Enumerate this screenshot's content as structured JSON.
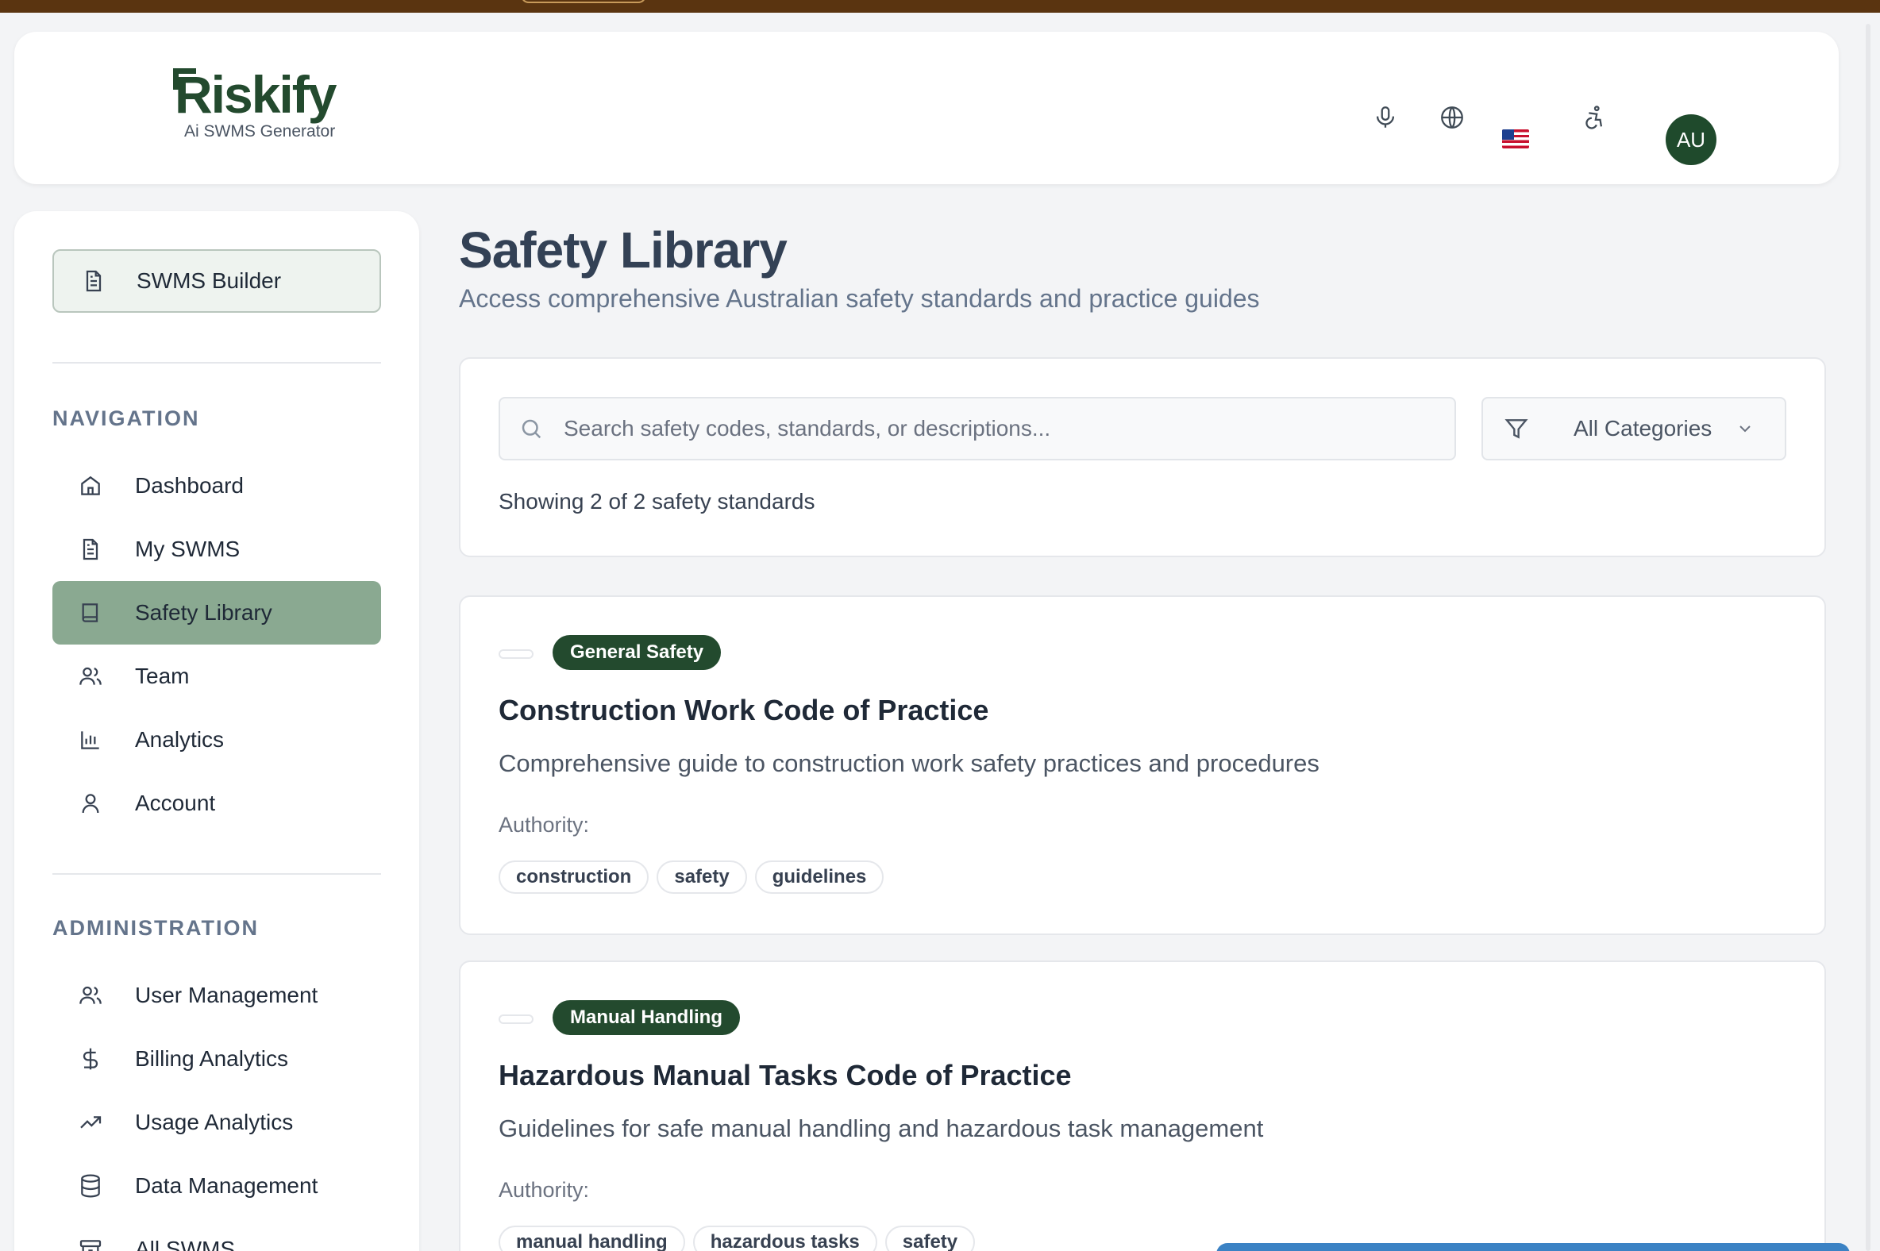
{
  "brand": {
    "name": "Riskify",
    "tagline": "Ai SWMS Generator"
  },
  "header": {
    "icons": [
      "microphone-icon",
      "globe-icon",
      "us-flag-icon",
      "accessibility-icon"
    ],
    "avatar_initials": "AU"
  },
  "sidebar": {
    "builder_label": "SWMS Builder",
    "navigation_title": "NAVIGATION",
    "navigation": [
      {
        "label": "Dashboard",
        "icon": "home-icon"
      },
      {
        "label": "My SWMS",
        "icon": "document-icon"
      },
      {
        "label": "Safety Library",
        "icon": "book-icon",
        "active": true
      },
      {
        "label": "Team",
        "icon": "users-icon"
      },
      {
        "label": "Analytics",
        "icon": "bar-chart-icon"
      },
      {
        "label": "Account",
        "icon": "user-icon"
      }
    ],
    "administration_title": "ADMINISTRATION",
    "administration": [
      {
        "label": "User Management",
        "icon": "users-icon"
      },
      {
        "label": "Billing Analytics",
        "icon": "dollar-icon"
      },
      {
        "label": "Usage Analytics",
        "icon": "trending-up-icon"
      },
      {
        "label": "Data Management",
        "icon": "database-icon"
      },
      {
        "label": "All SWMS",
        "icon": "archive-icon"
      }
    ]
  },
  "main": {
    "title": "Safety Library",
    "subtitle": "Access comprehensive Australian safety standards and practice guides",
    "search": {
      "placeholder": "Search safety codes, standards, or descriptions...",
      "value": ""
    },
    "category_filter": {
      "selected": "All Categories"
    },
    "result_count": "Showing 2 of 2 safety standards",
    "standards": [
      {
        "category": "General Safety",
        "title": "Construction Work Code of Practice",
        "description": "Comprehensive guide to construction work safety practices and procedures",
        "authority_label": "Authority:",
        "tags": [
          "construction",
          "safety",
          "guidelines"
        ]
      },
      {
        "category": "Manual Handling",
        "title": "Hazardous Manual Tasks Code of Practice",
        "description": "Guidelines for safe manual handling and hazardous task management",
        "authority_label": "Authority:",
        "tags": [
          "manual handling",
          "hazardous tasks",
          "safety"
        ]
      }
    ]
  },
  "colors": {
    "brand_green": "#234a2e",
    "active_nav": "#8aa991",
    "top_strip": "#5a3410"
  }
}
